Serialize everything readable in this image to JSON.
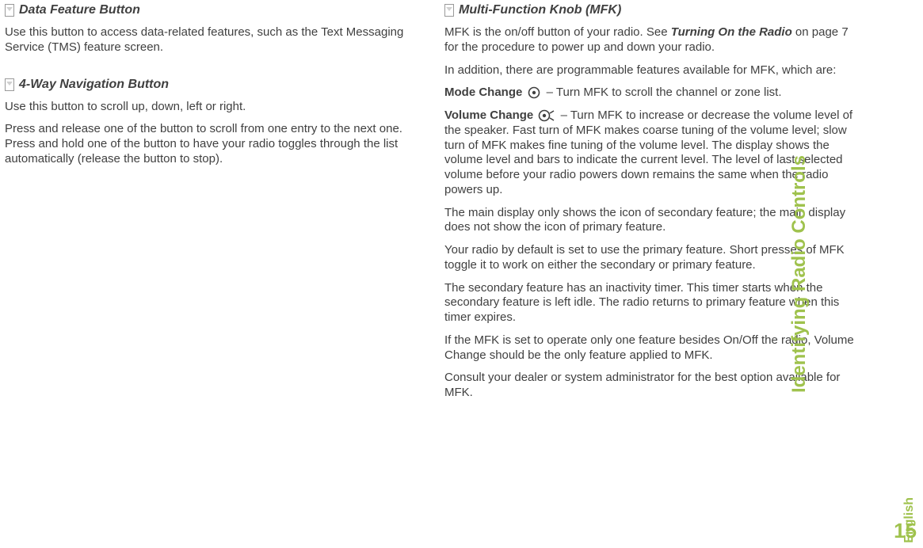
{
  "sidebar": {
    "chapterTitle": "Identifying Radio Controls",
    "language": "English",
    "pageNumber": "15"
  },
  "left": {
    "sectionA": {
      "title": "Data Feature Button",
      "p1": "Use this button to access data-related features, such as the Text Messaging Service (TMS) feature screen."
    },
    "sectionB": {
      "title": "4-Way Navigation Button",
      "p1": "Use this button to scroll up, down, left or right.",
      "p2": "Press and release one of the button to scroll from one entry to the next one. Press and hold one of the button to have your radio toggles through the list automatically (release the button to stop)."
    }
  },
  "right": {
    "sectionC": {
      "title": "Multi-Function Knob (MFK)",
      "p1a": "MFK is the on/off button of your radio. See ",
      "p1b": "Turning On the Radio",
      "p1c": " on page 7 for the procedure to power up and down your radio.",
      "p2": "In addition, there are programmable features available for MFK, which are:",
      "modeLabel": "Mode Change ",
      "modeText": " – Turn MFK to scroll the channel or zone list.",
      "volLabel": "Volume Change ",
      "volText": " – Turn MFK to increase or decrease the volume level of the speaker. Fast turn of MFK makes coarse tuning of the volume level; slow turn of MFK makes fine tuning of the volume level. The display shows the volume level and bars to indicate the current level. The level of last selected volume before your radio powers down remains the same when the radio powers up.",
      "p5": "The main display only shows the icon of secondary feature; the main display does not show the icon of primary feature.",
      "p6": "Your radio by default is set to use the primary feature. Short presses of MFK toggle it to work on either the secondary or primary feature.",
      "p7": "The secondary feature has an inactivity timer. This timer starts when the secondary feature is left idle. The radio returns to primary feature when this timer expires.",
      "p8": "If the MFK is set to operate only one feature besides On/Off the radio, Volume Change should be the only feature applied to MFK.",
      "p9": "Consult your dealer or system administrator for the best option available for MFK."
    }
  }
}
